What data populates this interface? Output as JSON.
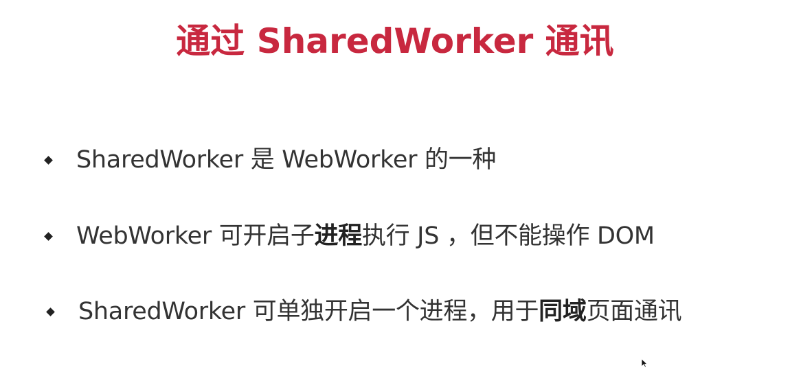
{
  "slide": {
    "title": "通过 SharedWorker 通讯",
    "bullets": [
      {
        "parts": [
          {
            "text": "SharedWorker 是 WebWorker 的一种",
            "bold": false
          }
        ]
      },
      {
        "parts": [
          {
            "text": "WebWorker 可开启子",
            "bold": false
          },
          {
            "text": "进程",
            "bold": true
          },
          {
            "text": "执行 JS ，但不能操作 DOM",
            "bold": false
          }
        ]
      },
      {
        "parts": [
          {
            "text": "SharedWorker 可单独开启一个进程，用于",
            "bold": false
          },
          {
            "text": "同域",
            "bold": true
          },
          {
            "text": "页面通讯",
            "bold": false
          }
        ]
      }
    ]
  },
  "colors": {
    "title": "#c8283f",
    "text": "#333333",
    "bullet": "#222222",
    "background": "#ffffff"
  },
  "icons": {
    "bullet": "diamond-bullet-icon",
    "cursor": "mouse-pointer-icon"
  }
}
